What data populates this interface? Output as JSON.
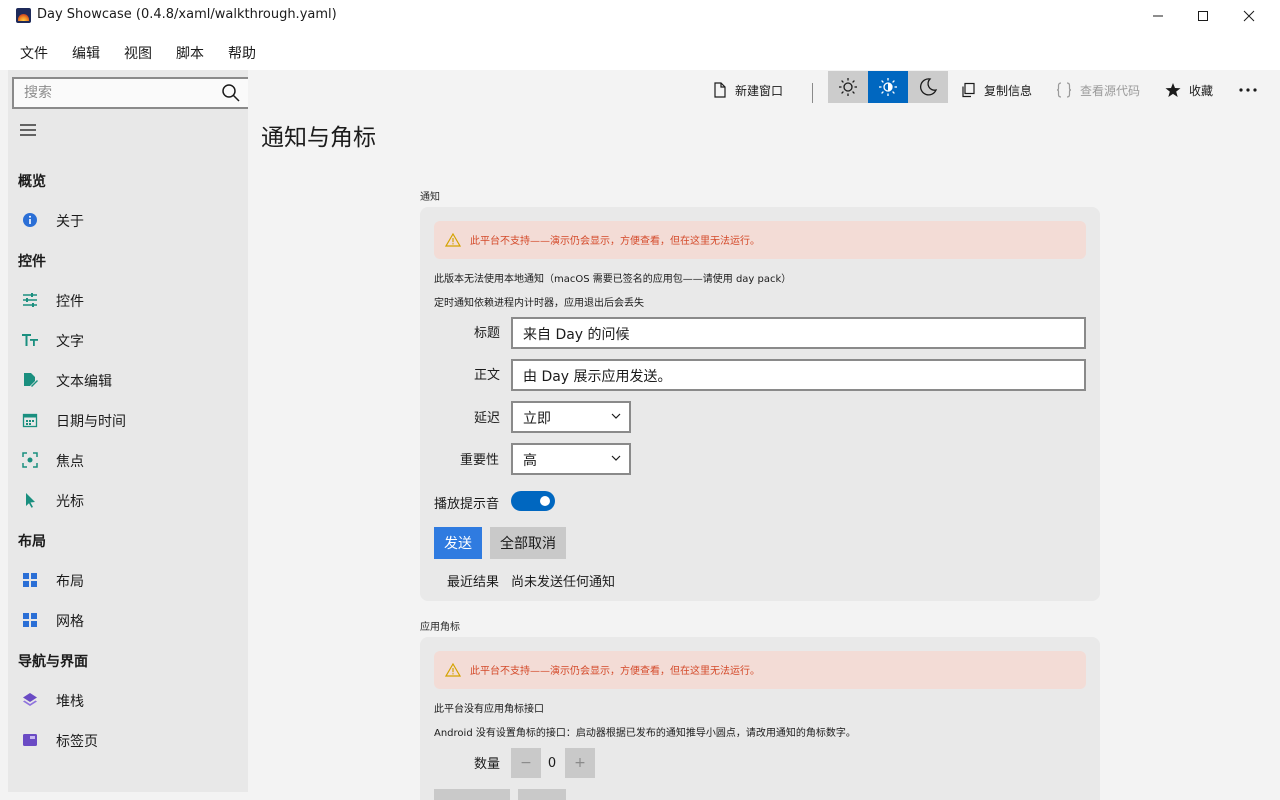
{
  "window": {
    "title": "Day Showcase (0.4.8/xaml/walkthrough.yaml)",
    "controls": [
      "minimize-icon",
      "maximize-icon",
      "close-icon"
    ]
  },
  "menu": {
    "items": [
      {
        "label": "文件"
      },
      {
        "label": "编辑"
      },
      {
        "label": "视图"
      },
      {
        "label": "脚本"
      },
      {
        "label": "帮助"
      }
    ]
  },
  "sidebar": {
    "search_placeholder": "搜索",
    "sections": [
      {
        "title": "概览",
        "items": [
          {
            "label": "关于",
            "icon": "info-icon"
          }
        ]
      },
      {
        "title": "控件",
        "items": [
          {
            "label": "控件",
            "icon": "sliders-icon"
          },
          {
            "label": "文字",
            "icon": "text-size-icon"
          },
          {
            "label": "文本编辑",
            "icon": "edit-document-icon"
          },
          {
            "label": "日期与时间",
            "icon": "calendar-icon"
          },
          {
            "label": "焦点",
            "icon": "focus-icon"
          },
          {
            "label": "光标",
            "icon": "cursor-icon"
          }
        ]
      },
      {
        "title": "布局",
        "items": [
          {
            "label": "布局",
            "icon": "layout-grid-icon"
          },
          {
            "label": "网格",
            "icon": "grid-icon"
          }
        ]
      },
      {
        "title": "导航与界面",
        "items": [
          {
            "label": "堆栈",
            "icon": "layers-icon"
          },
          {
            "label": "标签页",
            "icon": "tabs-icon"
          }
        ]
      }
    ]
  },
  "toolbar": {
    "new_window": "新建窗口",
    "copy_info": "复制信息",
    "view_source": "查看源代码",
    "favorite": "收藏",
    "theme_options": [
      "light-theme-icon",
      "auto-theme-icon",
      "dark-theme-icon"
    ],
    "theme_selected": "auto-theme-icon"
  },
  "page": {
    "title": "通知与角标"
  },
  "notification": {
    "group_label": "通知",
    "warning": "此平台不支持——演示仍会显示，方便查看，但在这里无法运行。",
    "info_line1": "此版本无法使用本地通知（macOS 需要已签名的应用包——请使用 day pack）",
    "info_line2": "定时通知依赖进程内计时器，应用退出后会丢失",
    "title_label": "标题",
    "title_value": "来自 Day 的问候",
    "body_label": "正文",
    "body_value": "由 Day 展示应用发送。",
    "delay_label": "延迟",
    "delay_value": "立即",
    "importance_label": "重要性",
    "importance_value": "高",
    "sound_label": "播放提示音",
    "sound_on": true,
    "send_button": "发送",
    "cancel_all_button": "全部取消",
    "last_result_label": "最近结果",
    "last_result_value": "尚未发送任何通知"
  },
  "badge": {
    "group_label": "应用角标",
    "warning": "此平台不支持——演示仍会显示，方便查看，但在这里无法运行。",
    "info_line1": "此平台没有应用角标接口",
    "info_line2": "Android 没有设置角标的接口：启动器根据已发布的通知推导小圆点，请改用通知的角标数字。",
    "count_label": "数量",
    "count_value": "0",
    "decrement": "−",
    "increment": "+"
  },
  "colors": {
    "accent": "#0067c0",
    "primary_button": "#2f7be0",
    "warning_text": "#d44a2a",
    "warning_bg": "#f3dcd6",
    "nav_icon_teal": "#1a8f7f",
    "nav_icon_blue": "#2b6fd6",
    "nav_icon_purple": "#6a4bc4"
  }
}
